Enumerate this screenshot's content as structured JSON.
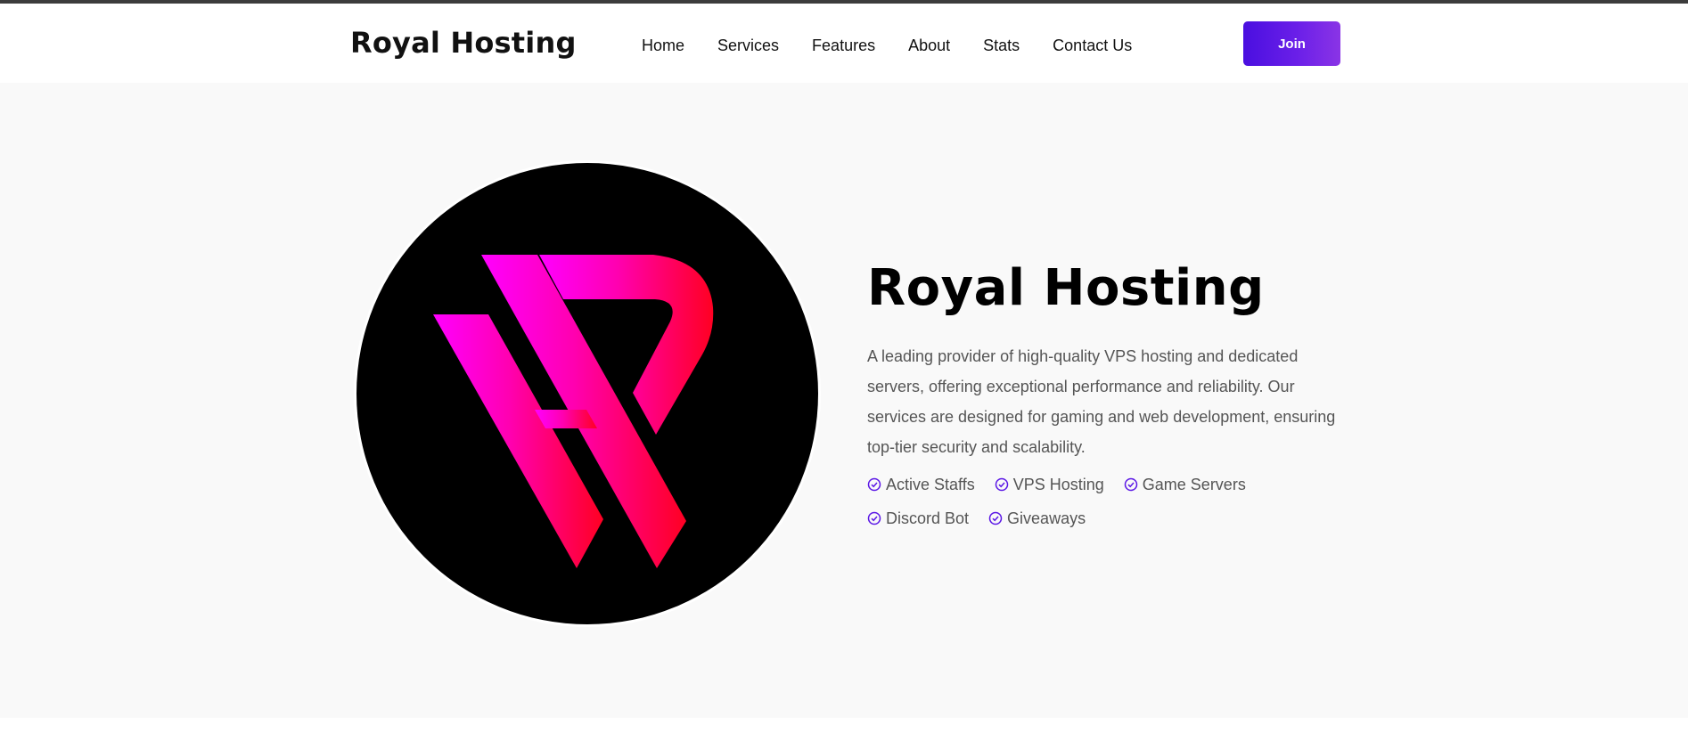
{
  "header": {
    "brand": "Royal Hosting",
    "nav": [
      "Home",
      "Services",
      "Features",
      "About",
      "Stats",
      "Contact Us"
    ],
    "join_label": "Join"
  },
  "hero": {
    "title": "Royal Hosting",
    "description": "A leading provider of high-quality VPS hosting and dedicated servers, offering exceptional performance and reliability. Our services are designed for gaming and web development, ensuring top-tier security and scalability.",
    "features": [
      "Active Staffs",
      "VPS Hosting",
      "Game Servers",
      "Discord Bot",
      "Giveaways"
    ],
    "feature_icon": "check-circle-icon"
  },
  "colors": {
    "accent": "#5b17e6",
    "accent_end": "#8a34e6",
    "logo_magenta": "#ff00ff",
    "logo_red": "#ff0022",
    "text_dark": "#111111",
    "text_muted": "#555555",
    "hero_bg": "#f9f9f9"
  }
}
